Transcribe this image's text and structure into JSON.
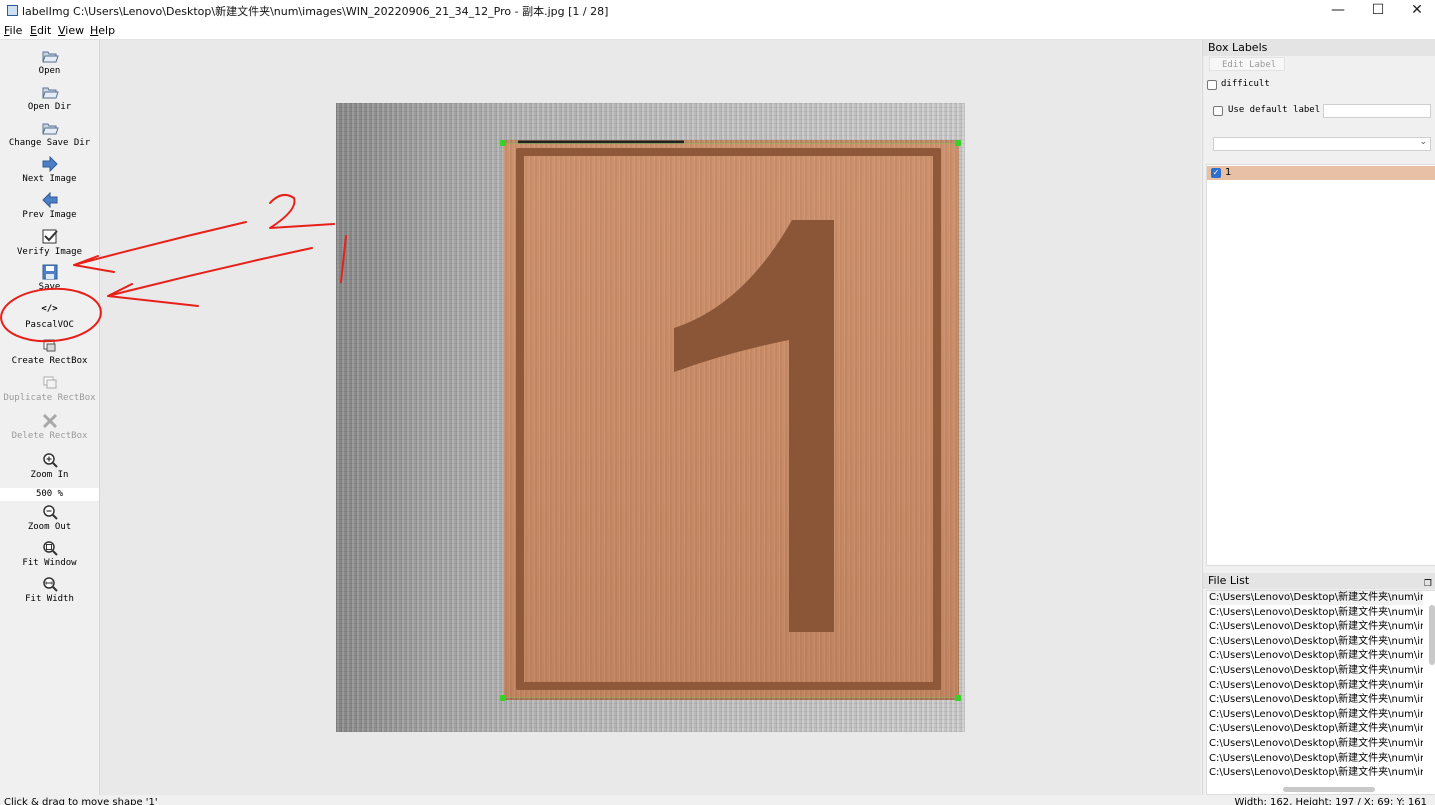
{
  "window": {
    "title": "labelImg C:\\Users\\Lenovo\\Desktop\\新建文件夹\\num\\images\\WIN_20220906_21_34_12_Pro - 副本.jpg [1 / 28]",
    "minimize": "—",
    "maximize": "☐",
    "close": "✕"
  },
  "menu": {
    "file": "File",
    "edit": "Edit",
    "view": "View",
    "help": "Help"
  },
  "toolbar": {
    "open": "Open",
    "open_dir": "Open Dir",
    "change_save_dir": "Change Save Dir",
    "next_image": "Next Image",
    "prev_image": "Prev Image",
    "verify_image": "Verify Image",
    "save": "Save",
    "format_icon": "</>",
    "format": "PascalVOC",
    "create_rectbox": "Create RectBox",
    "duplicate_rectbox": "Duplicate RectBox",
    "delete_rectbox": "Delete RectBox",
    "zoom_in": "Zoom In",
    "zoom_value": "500 %",
    "zoom_out": "Zoom Out",
    "fit_window": "Fit Window",
    "fit_width": "Fit Width"
  },
  "canvas": {
    "digit": "1",
    "annotation_marks": [
      "2",
      "1"
    ]
  },
  "box_labels": {
    "title": "Box Labels",
    "edit_label": "Edit Label",
    "difficult": "difficult",
    "use_default_label": "Use default label",
    "default_label_value": "",
    "labels": [
      {
        "name": "1",
        "checked": true
      }
    ]
  },
  "file_list": {
    "title": "File List",
    "items": [
      "C:\\Users\\Lenovo\\Desktop\\新建文件夹\\num\\in",
      "C:\\Users\\Lenovo\\Desktop\\新建文件夹\\num\\in",
      "C:\\Users\\Lenovo\\Desktop\\新建文件夹\\num\\in",
      "C:\\Users\\Lenovo\\Desktop\\新建文件夹\\num\\in",
      "C:\\Users\\Lenovo\\Desktop\\新建文件夹\\num\\in",
      "C:\\Users\\Lenovo\\Desktop\\新建文件夹\\num\\in",
      "C:\\Users\\Lenovo\\Desktop\\新建文件夹\\num\\in",
      "C:\\Users\\Lenovo\\Desktop\\新建文件夹\\num\\in",
      "C:\\Users\\Lenovo\\Desktop\\新建文件夹\\num\\in",
      "C:\\Users\\Lenovo\\Desktop\\新建文件夹\\num\\in",
      "C:\\Users\\Lenovo\\Desktop\\新建文件夹\\num\\in",
      "C:\\Users\\Lenovo\\Desktop\\新建文件夹\\num\\in",
      "C:\\Users\\Lenovo\\Desktop\\新建文件夹\\num\\in"
    ]
  },
  "status": {
    "message": "Click & drag to move shape '1'",
    "info": "Width: 162, Height: 197 / X: 69; Y: 161"
  },
  "colors": {
    "annotation_red": "#e8201a",
    "handle_green": "#39d126",
    "sign_brown": "#5f3218",
    "selected_label": "#e8c0a6"
  }
}
